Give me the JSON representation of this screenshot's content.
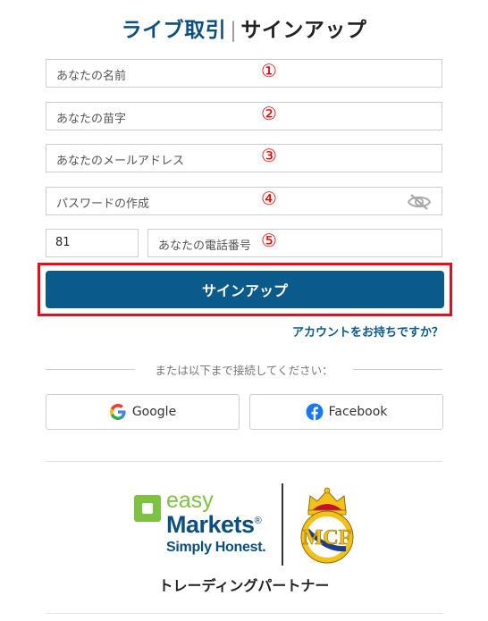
{
  "title": {
    "live": "ライブ取引",
    "sep": "|",
    "signup": "サインアップ"
  },
  "fields": {
    "first_name": {
      "placeholder": "あなたの名前",
      "marker": "①"
    },
    "last_name": {
      "placeholder": "あなたの苗字",
      "marker": "②"
    },
    "email": {
      "placeholder": "あなたのメールアドレス",
      "marker": "③"
    },
    "password": {
      "placeholder": "パスワードの作成",
      "marker": "④",
      "toggle_icon": "eye-slash-icon"
    },
    "country_code": {
      "value": "81"
    },
    "phone": {
      "placeholder": "あなたの電話番号",
      "marker": "⑤"
    }
  },
  "signup_button": "サインアップ",
  "have_account_link": "アカウントをお持ちですか？",
  "divider_text": "または以下まで接続してください：",
  "social": {
    "google": {
      "label": "Google",
      "icon": "google-icon"
    },
    "facebook": {
      "label": "Facebook",
      "icon": "facebook-icon"
    }
  },
  "brand": {
    "easy": "easy",
    "markets": "Markets",
    "registered": "®",
    "slogan": "Simply Honest.",
    "partner_logo": "real-madrid-crest"
  },
  "partner_text": "トレーディングパートナー",
  "colors": {
    "primary": "#0b5a8c",
    "title_blue": "#0b4f80",
    "highlight_red": "#e3101b",
    "marker_red": "#e30000",
    "easy_green": "#7dc242"
  }
}
